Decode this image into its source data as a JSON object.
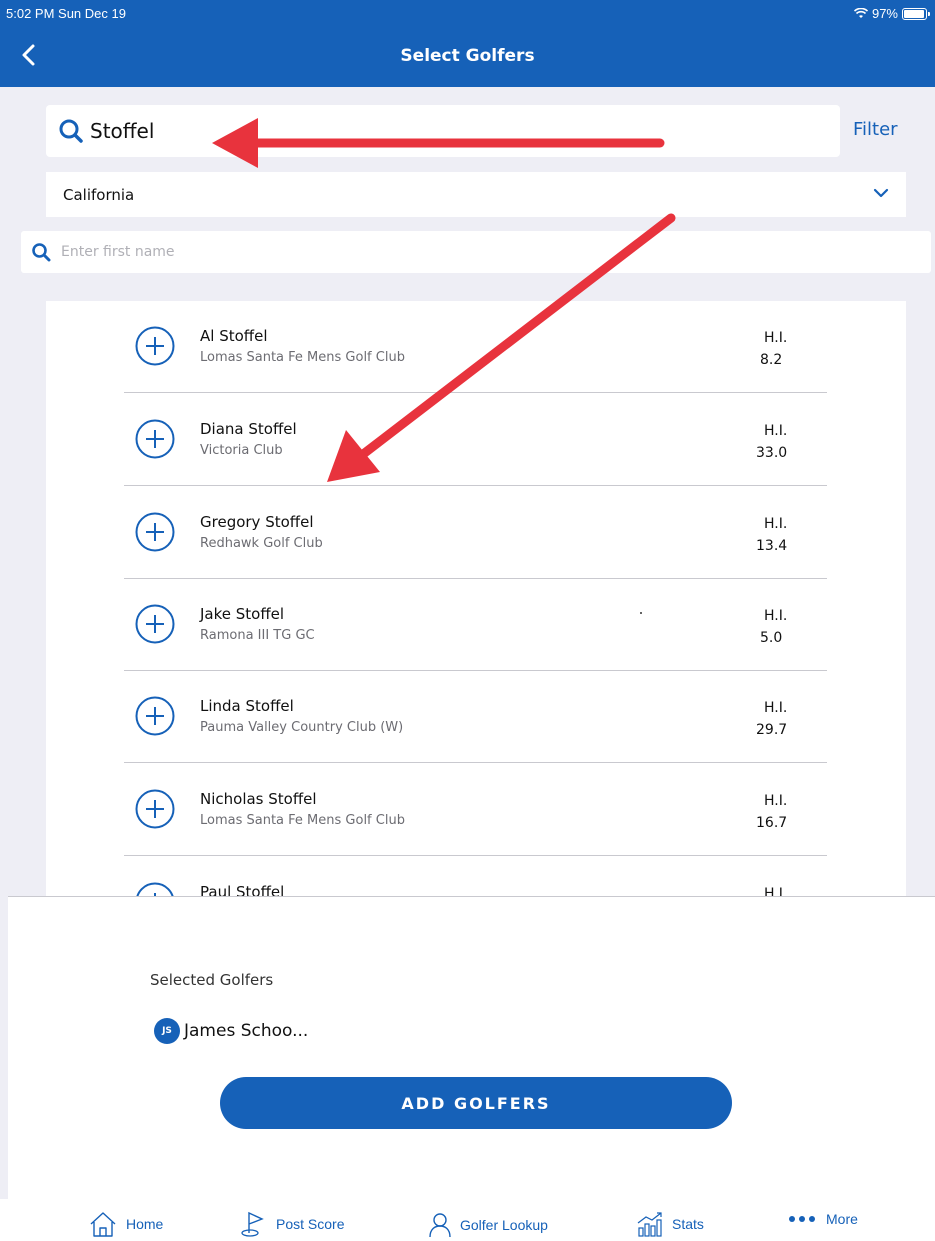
{
  "status": {
    "time": "5:02 PM  Sun Dec 19",
    "battery": "97%",
    "battery_level": 0.97
  },
  "header": {
    "title": "Select Golfers"
  },
  "search": {
    "value": "Stoffel",
    "filter_label": "Filter"
  },
  "state_select": {
    "value": "California"
  },
  "first_name": {
    "placeholder": "Enter first name"
  },
  "golfers": [
    {
      "name": "Al Stoffel",
      "club": "Lomas Santa Fe Mens Golf Club",
      "hi_label": "H.I.",
      "hi": "8.2"
    },
    {
      "name": "Diana Stoffel",
      "club": "Victoria Club",
      "hi_label": "H.I.",
      "hi": "33.0"
    },
    {
      "name": "Gregory Stoffel",
      "club": "Redhawk Golf Club",
      "hi_label": "H.I.",
      "hi": "13.4"
    },
    {
      "name": "Jake Stoffel",
      "club": "Ramona III TG GC",
      "hi_label": "H.I.",
      "hi": "5.0"
    },
    {
      "name": "Linda Stoffel",
      "club": "Pauma Valley Country Club (W)",
      "hi_label": "H.I.",
      "hi": "29.7"
    },
    {
      "name": "Nicholas Stoffel",
      "club": "Lomas Santa Fe Mens Golf Club",
      "hi_label": "H.I.",
      "hi": "16.7"
    },
    {
      "name": "Paul Stoffel",
      "club": "",
      "hi_label": "H.I.",
      "hi": ""
    }
  ],
  "selected": {
    "title": "Selected Golfers",
    "golfers": [
      {
        "initials": "JS",
        "name": "James Schoo..."
      }
    ]
  },
  "add_button": {
    "label": "ADD GOLFERS"
  },
  "tabs": [
    {
      "label": "Home",
      "icon": "home-icon"
    },
    {
      "label": "Post Score",
      "icon": "golf-flag-icon"
    },
    {
      "label": "Golfer Lookup",
      "icon": "person-icon"
    },
    {
      "label": "Stats",
      "icon": "chart-icon"
    },
    {
      "label": "More",
      "icon": "more-dots-icon"
    }
  ],
  "colors": {
    "brand": "#1661b8",
    "annotation_arrow": "#e8333d"
  }
}
